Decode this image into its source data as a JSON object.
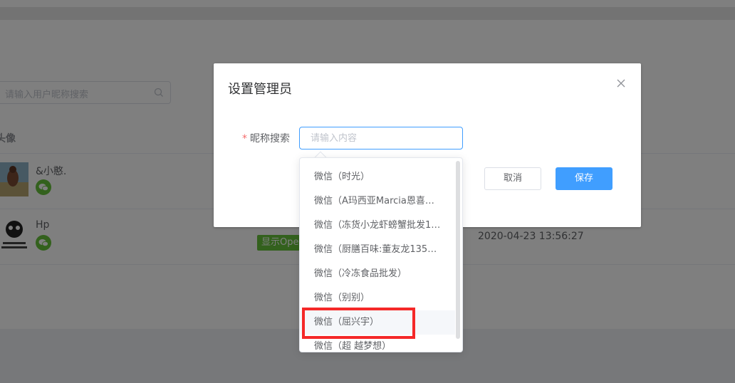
{
  "background": {
    "search_placeholder": "请输入用户昵称搜索",
    "table_header_avatar": "头像",
    "rows": [
      {
        "nickname": "&小憨."
      },
      {
        "nickname": "Hp",
        "tag": "显示Ope",
        "date": "2020-04-23 13:56:27"
      }
    ]
  },
  "dialog": {
    "title": "设置管理员",
    "field_label": "昵称搜索",
    "required_mark": "*",
    "input_placeholder": "请输入内容",
    "input_value": "",
    "cancel_label": "取消",
    "save_label": "保存"
  },
  "dropdown": {
    "items": [
      "微信（时光）",
      "微信（A玛西亚Marcia恩喜…",
      "微信（冻货小龙虾螃蟹批发1…",
      "微信（厨膳百味:董友龙1355…",
      "微信（冷冻食品批发）",
      "微信（别别）",
      "微信（屈兴宇）",
      "微信（超  越梦想）"
    ],
    "highlighted_index": 6
  },
  "colors": {
    "primary": "#409eff",
    "wechat_green": "#67c23a",
    "highlight_red": "#f52828",
    "required_red": "#f56c6c"
  }
}
